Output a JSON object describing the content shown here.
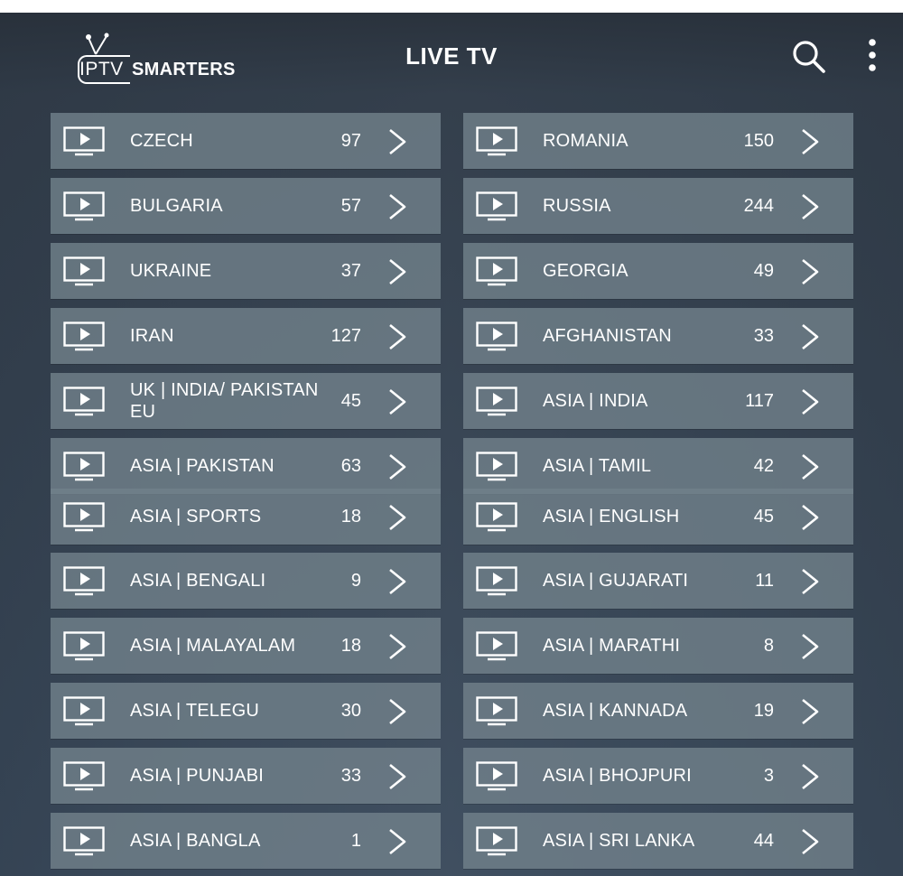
{
  "app": {
    "logo_left": "IPTV",
    "logo_right": "SMARTERS",
    "title": "LIVE TV"
  },
  "icons": {
    "search": "search-icon",
    "menu": "more-vertical-icon",
    "item": "tv-play-icon",
    "arrow": "chevron-right-icon"
  },
  "colors": {
    "text": "#ffffff",
    "row_bg": "#70808a"
  },
  "categories": [
    {
      "name": "CZECH",
      "count": "97"
    },
    {
      "name": "ROMANIA",
      "count": "150"
    },
    {
      "name": "BULGARIA",
      "count": "57"
    },
    {
      "name": "RUSSIA",
      "count": "244"
    },
    {
      "name": "UKRAINE",
      "count": "37"
    },
    {
      "name": "GEORGIA",
      "count": "49"
    },
    {
      "name": "IRAN",
      "count": "127"
    },
    {
      "name": "AFGHANISTAN",
      "count": "33"
    },
    {
      "name": "UK | INDIA/ PAKISTAN EU",
      "count": "45"
    },
    {
      "name": "ASIA | INDIA",
      "count": "117"
    },
    {
      "name": "ASIA | PAKISTAN",
      "count": "63"
    },
    {
      "name": "ASIA | TAMIL",
      "count": "42"
    },
    {
      "name": "ASIA | SPORTS",
      "count": "18"
    },
    {
      "name": "ASIA | ENGLISH",
      "count": "45"
    },
    {
      "name": "ASIA | BENGALI",
      "count": "9"
    },
    {
      "name": "ASIA | GUJARATI",
      "count": "11"
    },
    {
      "name": "ASIA | MALAYALAM",
      "count": "18"
    },
    {
      "name": "ASIA | MARATHI",
      "count": "8"
    },
    {
      "name": "ASIA | TELEGU",
      "count": "30"
    },
    {
      "name": "ASIA | KANNADA",
      "count": "19"
    },
    {
      "name": "ASIA | PUNJABI",
      "count": "33"
    },
    {
      "name": "ASIA | BHOJPURI",
      "count": "3"
    },
    {
      "name": "ASIA | BANGLA",
      "count": "1"
    },
    {
      "name": "ASIA | SRI LANKA",
      "count": "44"
    }
  ]
}
